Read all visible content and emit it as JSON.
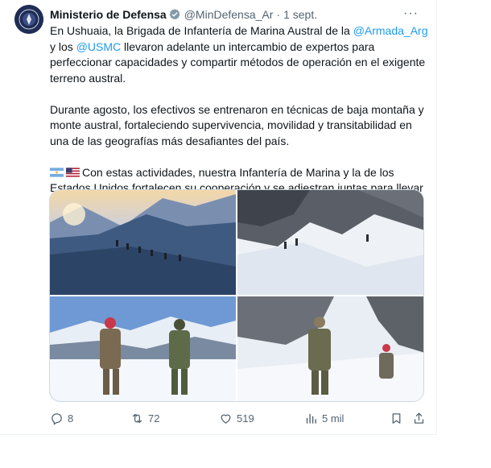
{
  "tweet": {
    "author_name": "Ministerio de Defensa",
    "handle": "@MinDefensa_Ar",
    "separator": "·",
    "date": "1 sept.",
    "more": "···",
    "p1": {
      "t1": "En Ushuaia, la Brigada de Infantería de Marina Austral de la ",
      "m1": "@Armada_Arg",
      "t2": " y los ",
      "m2": "@USMC",
      "t3": " llevaron adelante un intercambio de expertos para perfeccionar capacidades y compartir métodos de operación en el exigente terreno austral."
    },
    "p2": "Durante agosto, los efectivos se entrenaron en técnicas de baja montaña y monte austral, fortaleciendo supervivencia, movilidad y transitabilidad en una de las geografías más desafiantes del país.",
    "p3": "Con estas actividades, nuestra Infantería de Marina y la de los Estados Unidos fortalecen su cooperación y se adiestran juntas para llevar sus capacidades operativas al máximo nivel.",
    "flags": [
      "argentina-flag",
      "usa-flag"
    ]
  },
  "actions": {
    "replies": "8",
    "retweets": "72",
    "likes": "519",
    "views": "5 mil"
  },
  "icons": [
    "verified-icon",
    "reply-icon",
    "retweet-icon",
    "like-icon",
    "views-icon",
    "bookmark-icon",
    "share-icon"
  ],
  "colors": {
    "accent": "#1d9bf0",
    "muted": "#536471",
    "text": "#0f1419"
  }
}
